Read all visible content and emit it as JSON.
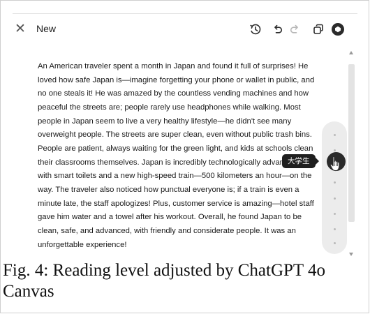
{
  "header": {
    "title": "New",
    "icons": [
      "close-icon",
      "history-icon",
      "undo-icon",
      "redo-icon",
      "copy-icon",
      "brand-icon"
    ]
  },
  "document": {
    "text": "An American traveler spent a month in Japan and found it full of surprises! He loved how safe Japan is—imagine forgetting your phone or wallet in public, and no one steals it! He was amazed by the countless vending machines and how peaceful the streets are; people rarely use headphones while walking. Most people in Japan seem to live a very healthy lifestyle—he didn't see many overweight people. The streets are super clean, even without public trash bins. People are patient, always waiting for the green light, and kids at schools clean their classrooms themselves. Japan is incredibly technologically advanced, with smart toilets and a new high-speed train—500 kilometers an hour—on the way. The traveler also noticed how punctual everyone is; if a train is even a minute late, the staff apologizes! Plus, customer service is amazing—hotel staff gave him water and a towel after his workout. Overall, he found Japan to be clean, safe, and advanced, with friendly and considerate people. It was an unforgettable experience!"
  },
  "reading_level": {
    "tooltip": "大学生"
  },
  "caption": "Fig. 4: Reading level adjusted by ChatGPT 4o Canvas",
  "colors": {
    "knob": "#2b2b2b",
    "rail": "#ececec",
    "tooltip_bg": "#1f1f1f"
  }
}
